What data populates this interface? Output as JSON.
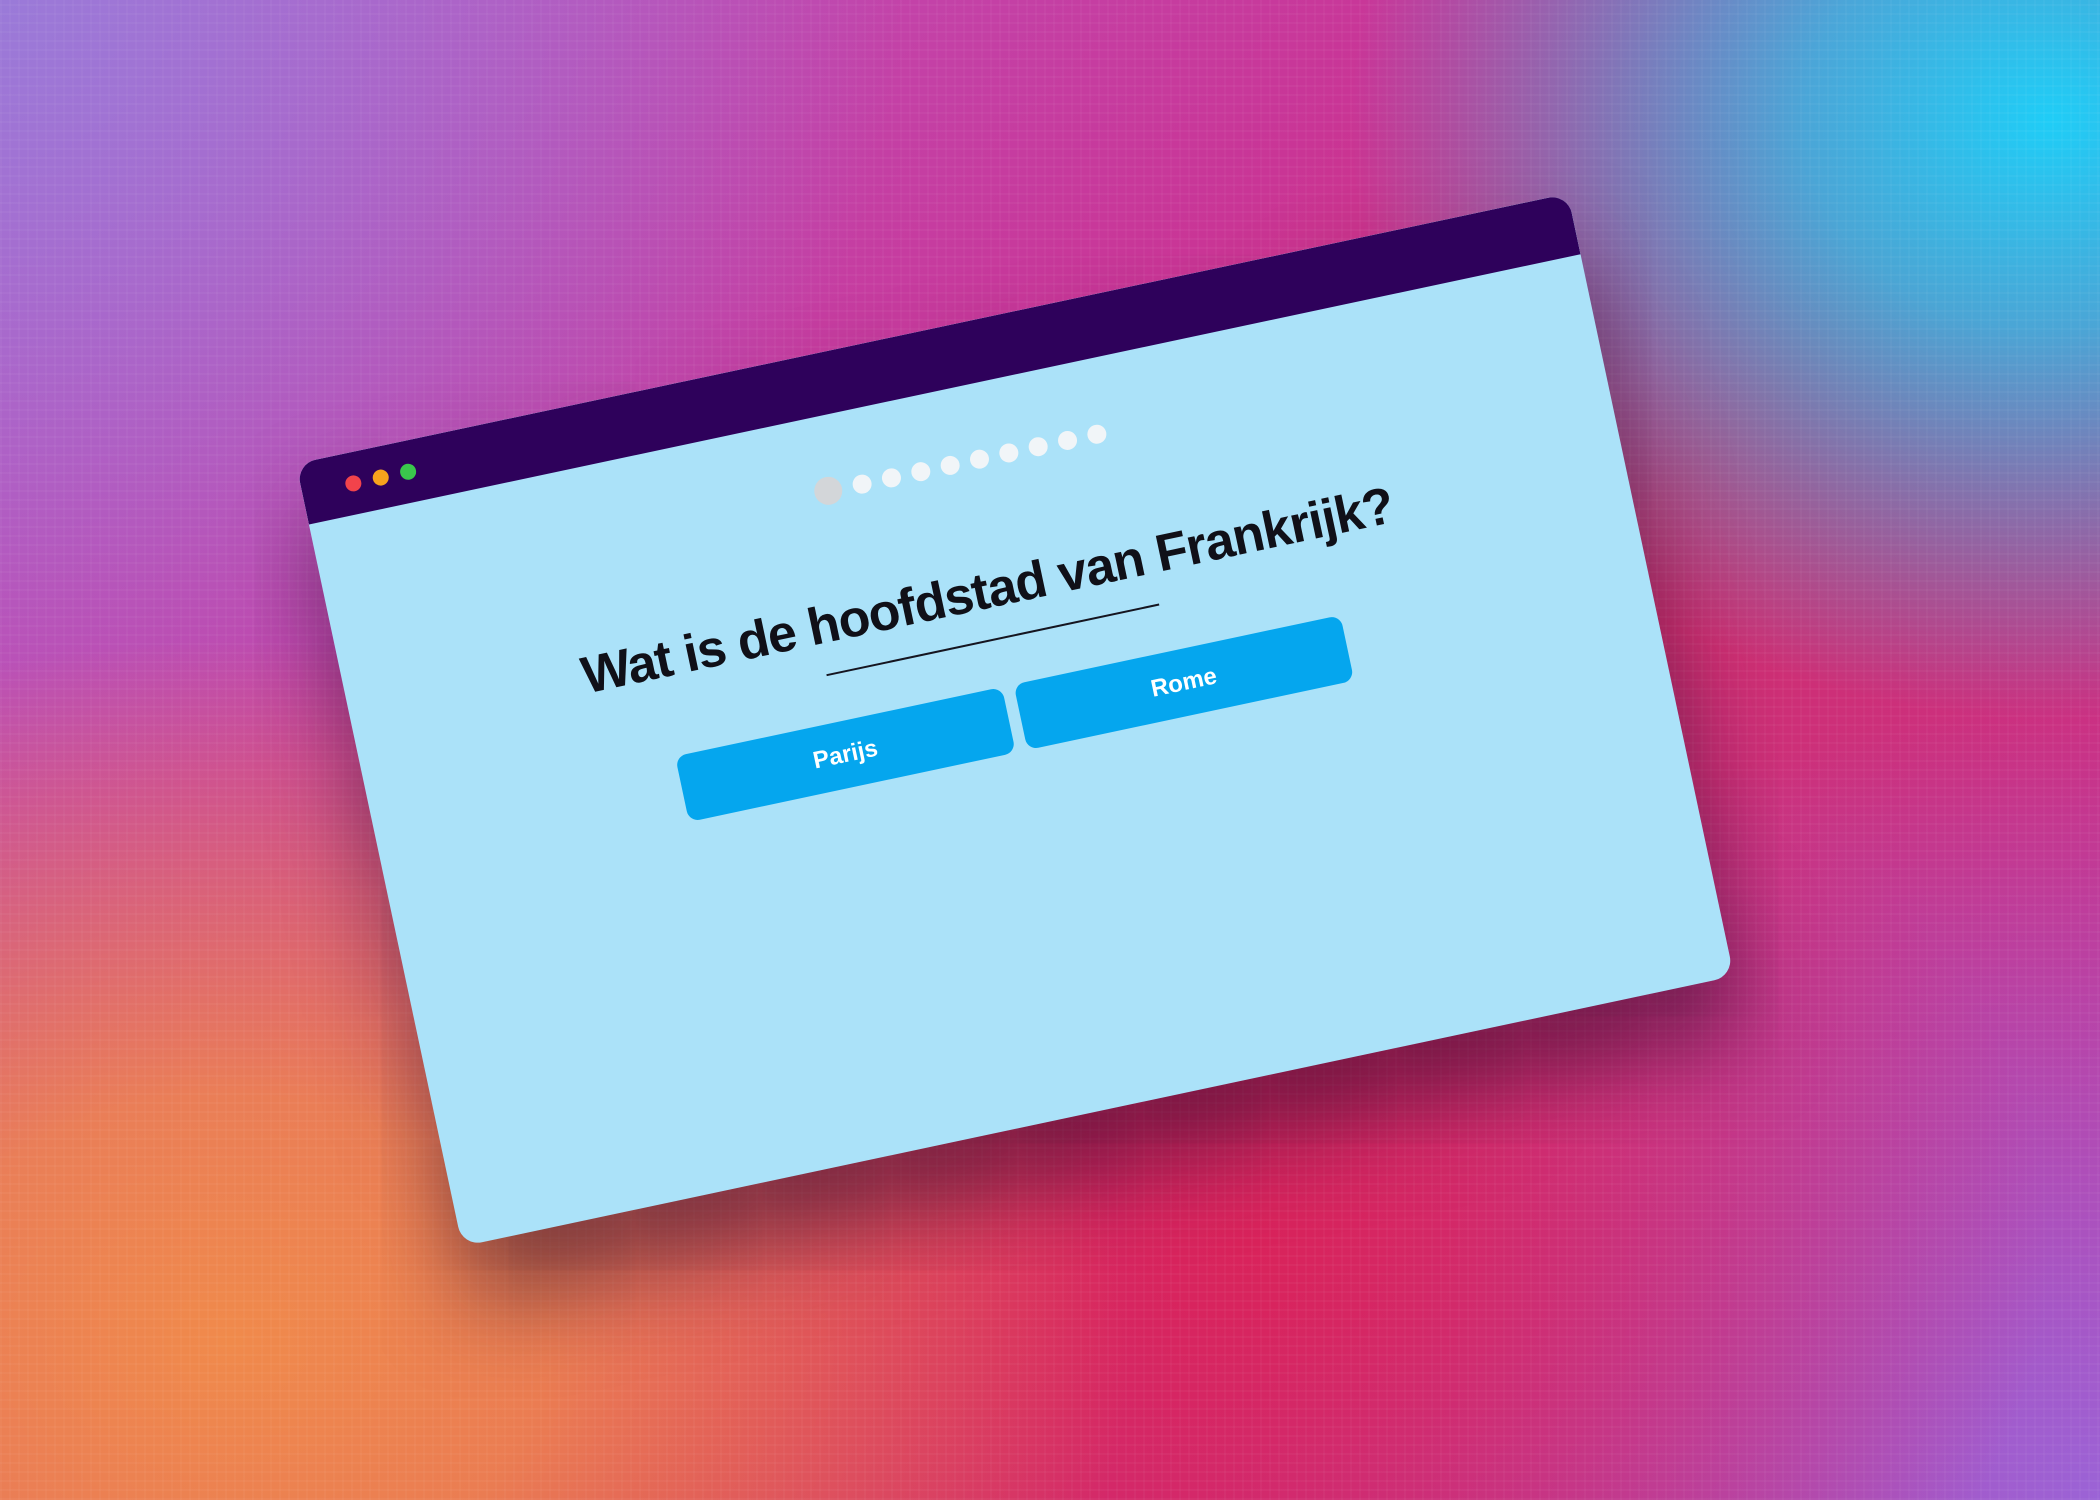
{
  "window": {
    "controls": {
      "close_color": "#f2434b",
      "minimize_color": "#f7a31c",
      "maximize_color": "#3ac74c"
    },
    "titlebar_color": "#2e015b",
    "background_color": "#abe2f9"
  },
  "quiz": {
    "progress": {
      "total": 10,
      "current": 1
    },
    "question": "Wat is de hoofdstad van Frankrijk?",
    "answers": [
      {
        "label": "Parijs"
      },
      {
        "label": "Rome"
      }
    ],
    "answer_color": "#05a6ee"
  }
}
